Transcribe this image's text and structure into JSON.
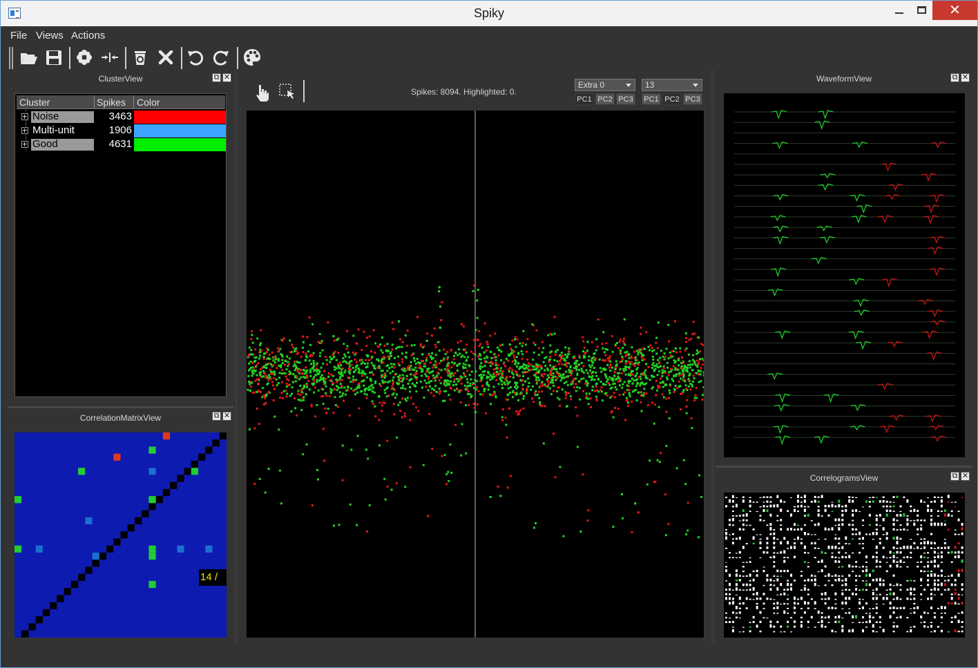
{
  "window": {
    "title": "Spiky"
  },
  "menu": [
    "File",
    "Views",
    "Actions"
  ],
  "toolbar": {
    "icons": [
      "open-folder-icon",
      "save-icon",
      "cluster-flower-icon",
      "split-arrows-icon",
      "delete-trash-icon",
      "close-x-icon",
      "undo-icon",
      "redo-icon",
      "palette-icon"
    ]
  },
  "cluster_view": {
    "title": "ClusterView",
    "headers": [
      "Cluster",
      "Spikes",
      "Color"
    ],
    "rows": [
      {
        "name": "Noise",
        "spikes": "3463",
        "color": "#ff0000",
        "selected": true
      },
      {
        "name": "Multi-unit",
        "spikes": "1906",
        "color": "#3ca4ff",
        "selected": false
      },
      {
        "name": "Good",
        "spikes": "4631",
        "color": "#00ee00",
        "selected": true
      }
    ]
  },
  "correlation_matrix_view": {
    "title": "CorrelationMatrixView",
    "tooltip": "14 /",
    "grid_size": 30,
    "colors": {
      "background": "#0d1bb0",
      "diagonal": "#000000",
      "high": "#e03a1a",
      "mid": "#22cc33",
      "low": "#1a6fd0"
    }
  },
  "feature_view": {
    "status": "Spikes: 8094. Highlighted: 0.",
    "combo_x": "Extra 0",
    "combo_y": "13",
    "pc_buttons_x": [
      "PC1",
      "PC2",
      "PC3"
    ],
    "pc_buttons_y": [
      "PC1",
      "PC2",
      "PC3"
    ],
    "colors": {
      "good": "#22d322",
      "noise": "#e01818"
    }
  },
  "waveform_view": {
    "title": "WaveformView"
  },
  "correlograms_view": {
    "title": "CorrelogramsView"
  }
}
